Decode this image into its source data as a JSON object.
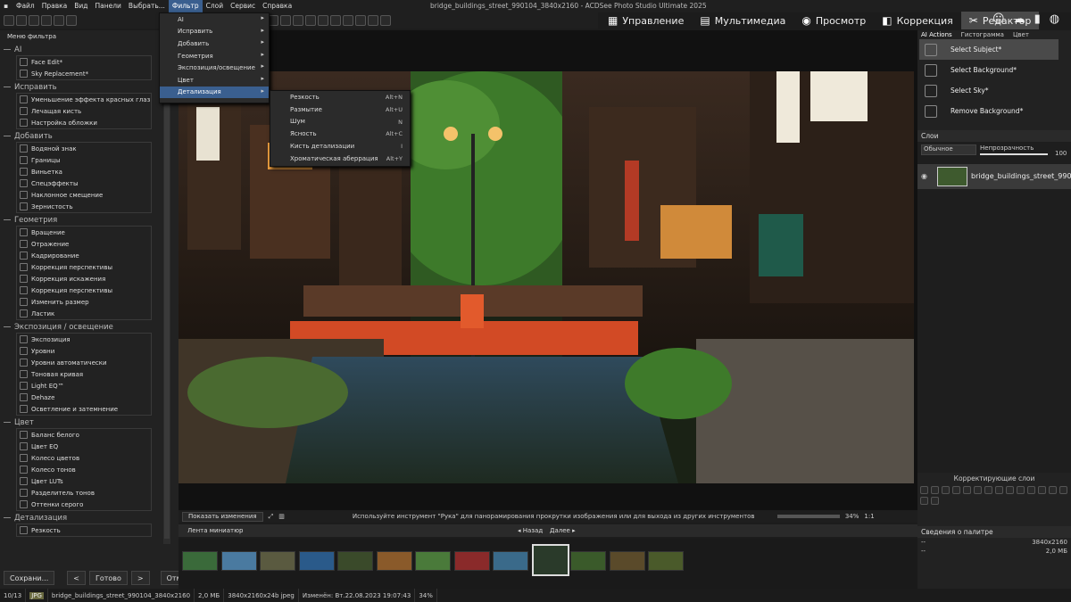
{
  "window": {
    "title": "bridge_buildings_street_990104_3840x2160 - ACDSee Photo Studio Ultimate 2025"
  },
  "menu": [
    {
      "label": "Файл"
    },
    {
      "label": "Правка"
    },
    {
      "label": "Вид"
    },
    {
      "label": "Панели"
    },
    {
      "label": "Выбрать..."
    },
    {
      "label": "Фильтр"
    },
    {
      "label": "Слой"
    },
    {
      "label": "Сервис"
    },
    {
      "label": "Справка"
    }
  ],
  "mode_tabs": [
    {
      "label": "Управление",
      "icon": "grid-icon"
    },
    {
      "label": "Мультимедиа",
      "icon": "media-icon"
    },
    {
      "label": "Просмотр",
      "icon": "eye-icon"
    },
    {
      "label": "Коррекция",
      "icon": "develop-icon"
    },
    {
      "label": "Редактор",
      "icon": "edit-icon"
    }
  ],
  "filter_menu": {
    "items": [
      {
        "label": "AI"
      },
      {
        "label": "Исправить"
      },
      {
        "label": "Добавить"
      },
      {
        "label": "Геометрия"
      },
      {
        "label": "Экспозиция/освещение"
      },
      {
        "label": "Цвет"
      },
      {
        "label": "Детализация"
      }
    ],
    "submenu": [
      {
        "label": "Резкость",
        "shortcut": "Alt+N"
      },
      {
        "label": "Размытие",
        "shortcut": "Alt+U"
      },
      {
        "label": "Шум",
        "shortcut": "N"
      },
      {
        "label": "Ясность",
        "shortcut": "Alt+C"
      },
      {
        "label": "Кисть детализации",
        "shortcut": "I"
      },
      {
        "label": "Хроматическая аберрация",
        "shortcut": "Alt+Y"
      }
    ]
  },
  "left_panel": {
    "title": "Меню фильтра",
    "sections": [
      {
        "title": "AI",
        "items": [
          "Face Edit*",
          "Sky Replacement*"
        ]
      },
      {
        "title": "Исправить",
        "items": [
          "Уменьшение эффекта красных глаз",
          "Лечащая кисть",
          "Настройка обложки"
        ]
      },
      {
        "title": "Добавить",
        "items": [
          "Водяной знак",
          "Границы",
          "Виньетка",
          "Спецэффекты",
          "Наклонное смещение",
          "Зернистость"
        ]
      },
      {
        "title": "Геометрия",
        "items": [
          "Вращение",
          "Отражение",
          "Кадрирование",
          "Коррекция перспективы",
          "Коррекция искажения",
          "Коррекция перспективы",
          "Изменить размер",
          "Ластик"
        ]
      },
      {
        "title": "Экспозиция / освещение",
        "items": [
          "Экспозиция",
          "Уровни",
          "Уровни автоматически",
          "Тоновая кривая",
          "Light EQ™",
          "Dehaze",
          "Осветление и затемнение"
        ]
      },
      {
        "title": "Цвет",
        "items": [
          "Баланс белого",
          "Цвет EQ",
          "Колесо цветов",
          "Колесо тонов",
          "Цвет LUTs",
          "Разделитель тонов",
          "Оттенки серого"
        ]
      },
      {
        "title": "Детализация",
        "items": [
          "Резкость"
        ]
      }
    ],
    "buttons": {
      "save": "Сохрани...",
      "done": "Готово",
      "cancel": "Отмена"
    }
  },
  "canvas_status": {
    "show_changes": "Показать изменения",
    "hint": "Используйте инструмент \"Рука\" для панорамирования прокрутки изображения или для выхода из других инструментов рисования или вы...",
    "zoom": "34%",
    "ratio": "1:1"
  },
  "filmstrip": {
    "title": "Лента миниатюр",
    "back": "Назад",
    "next": "Далее",
    "thumb_count": 13,
    "selected_index": 9
  },
  "right_panel": {
    "tabs": [
      "AI Actions",
      "Гистограмма",
      "Цвет"
    ],
    "ai_actions": [
      "Select Subject*",
      "Select Background*",
      "Select Sky*",
      "Remove Background*"
    ],
    "layers": {
      "title": "Слои",
      "blend": "Обычное",
      "opacity_label": "Непрозрачность",
      "opacity_value": "100",
      "layer_name": "bridge_buildings_street_990..."
    },
    "adjustment_title": "Корректирующие слои",
    "palette_title": "Сведения о палитре",
    "palette_rows": [
      [
        "--",
        "3840x2160"
      ],
      [
        "--",
        "2,0 МБ"
      ]
    ]
  },
  "statusbar": {
    "count": "10/13",
    "format": "JPG",
    "filename": "bridge_buildings_street_990104_3840x2160",
    "size": "2,0 МБ",
    "dims": "3840x2160x24b jpeg",
    "modified": "Изменён: Вт.22.08.2023 19:07:43",
    "zoom": "34%"
  }
}
